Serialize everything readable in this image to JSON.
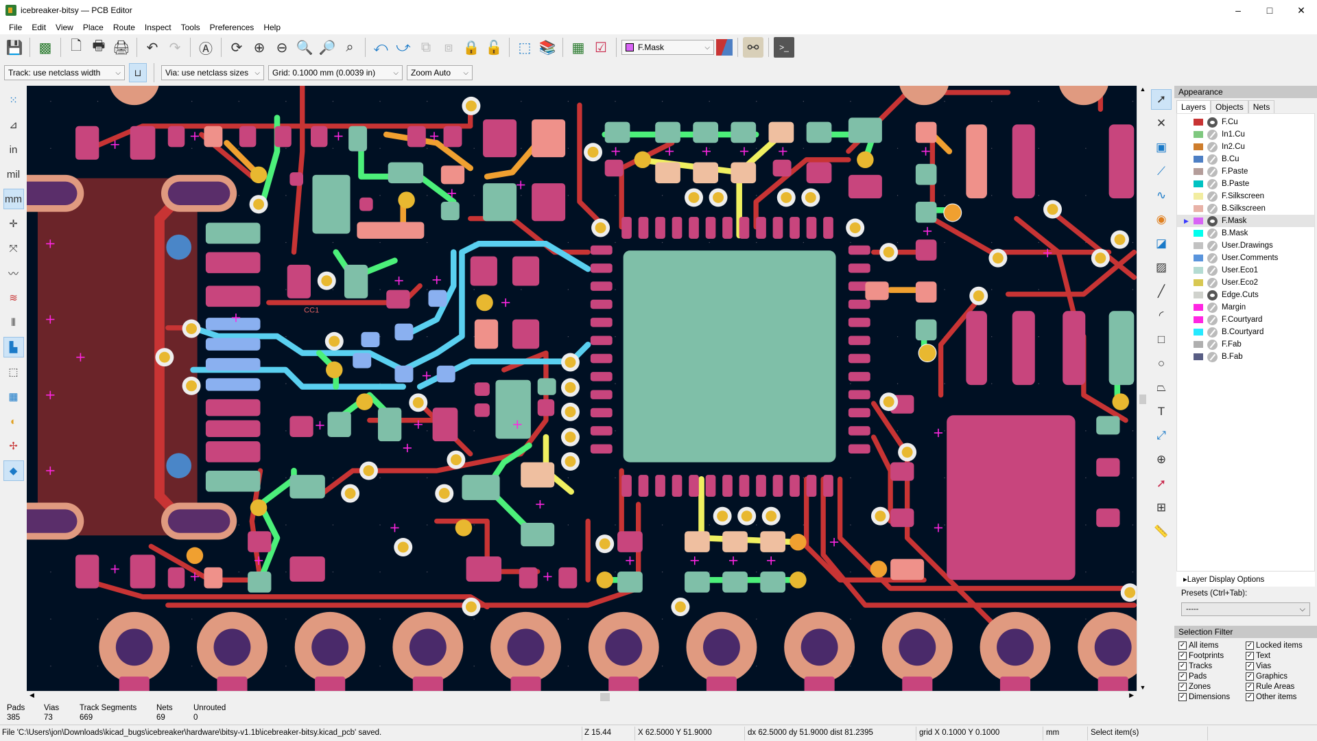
{
  "window": {
    "title": "icebreaker-bitsy — PCB Editor",
    "minimize": "–",
    "maximize": "□",
    "close": "✕"
  },
  "menu": [
    "File",
    "Edit",
    "View",
    "Place",
    "Route",
    "Inspect",
    "Tools",
    "Preferences",
    "Help"
  ],
  "toolbar": {
    "track_width": "Track: use netclass width",
    "via_size": "Via: use netclass sizes",
    "grid": "Grid: 0.1000 mm (0.0039 in)",
    "zoom": "Zoom Auto",
    "active_layer": "F.Mask",
    "active_layer_color": "#d864f5"
  },
  "left_toolbar": {
    "units_in": "in",
    "units_mil": "mil",
    "units_mm": "mm",
    "active_unit": "mm"
  },
  "appearance": {
    "title": "Appearance",
    "tabs": [
      "Layers",
      "Objects",
      "Nets"
    ],
    "active_tab": "Layers",
    "layers": [
      {
        "name": "F.Cu",
        "color": "#c83434",
        "visible": true
      },
      {
        "name": "In1.Cu",
        "color": "#7fc87f",
        "visible": false
      },
      {
        "name": "In2.Cu",
        "color": "#ce7d2c",
        "visible": false
      },
      {
        "name": "B.Cu",
        "color": "#4d7fc4",
        "visible": false
      },
      {
        "name": "F.Paste",
        "color": "#b49d9a",
        "visible": false
      },
      {
        "name": "B.Paste",
        "color": "#00c2c2",
        "visible": false
      },
      {
        "name": "F.Silkscreen",
        "color": "#f2eda1",
        "visible": false
      },
      {
        "name": "B.Silkscreen",
        "color": "#e8b2a7",
        "visible": false
      },
      {
        "name": "F.Mask",
        "color": "#d864f5",
        "visible": true,
        "active": true
      },
      {
        "name": "B.Mask",
        "color": "#02ffee",
        "visible": false
      },
      {
        "name": "User.Drawings",
        "color": "#c2c2c2",
        "visible": false
      },
      {
        "name": "User.Comments",
        "color": "#5994dc",
        "visible": false
      },
      {
        "name": "User.Eco1",
        "color": "#b4dbd2",
        "visible": false
      },
      {
        "name": "User.Eco2",
        "color": "#d8c852",
        "visible": false
      },
      {
        "name": "Edge.Cuts",
        "color": "#d0d2cd",
        "visible": true
      },
      {
        "name": "Margin",
        "color": "#ff26e2",
        "visible": false
      },
      {
        "name": "F.Courtyard",
        "color": "#ff26e2",
        "visible": false
      },
      {
        "name": "B.Courtyard",
        "color": "#26e9ff",
        "visible": false
      },
      {
        "name": "F.Fab",
        "color": "#afafaf",
        "visible": false
      },
      {
        "name": "B.Fab",
        "color": "#585d84",
        "visible": false
      }
    ],
    "layer_display_options": "Layer Display Options",
    "presets_label": "Presets (Ctrl+Tab):",
    "presets_value": "-----"
  },
  "selection_filter": {
    "title": "Selection Filter",
    "items": [
      {
        "label": "All items",
        "checked": true
      },
      {
        "label": "Locked items",
        "checked": true
      },
      {
        "label": "Footprints",
        "checked": true
      },
      {
        "label": "Text",
        "checked": true
      },
      {
        "label": "Tracks",
        "checked": true
      },
      {
        "label": "Vias",
        "checked": true
      },
      {
        "label": "Pads",
        "checked": true
      },
      {
        "label": "Graphics",
        "checked": true
      },
      {
        "label": "Zones",
        "checked": true
      },
      {
        "label": "Rule Areas",
        "checked": true
      },
      {
        "label": "Dimensions",
        "checked": true
      },
      {
        "label": "Other items",
        "checked": true
      }
    ]
  },
  "canvas": {
    "ref_label": "CC1",
    "background": "#001023"
  },
  "message_panel": [
    {
      "label": "Pads",
      "value": "385"
    },
    {
      "label": "Vias",
      "value": "73"
    },
    {
      "label": "Track Segments",
      "value": "669"
    },
    {
      "label": "Nets",
      "value": "69"
    },
    {
      "label": "Unrouted",
      "value": "0"
    }
  ],
  "status": {
    "message": "File 'C:\\Users\\jon\\Downloads\\kicad_bugs\\icebreaker\\hardware\\bitsy-v1.1b\\icebreaker-bitsy.kicad_pcb' saved.",
    "zoom": "Z 15.44",
    "xy": "X 62.5000  Y 51.9000",
    "delta": "dx 62.5000  dy 51.9000  dist 81.2395",
    "grid": "grid X 0.1000  Y 0.1000",
    "units": "mm",
    "tool": "Select item(s)"
  }
}
